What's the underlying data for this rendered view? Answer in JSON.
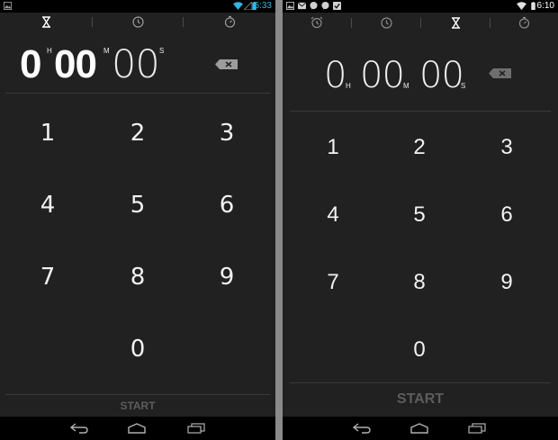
{
  "colors": {
    "background": "#212121",
    "status_bar": "#000000",
    "accent": "#33b5e5",
    "digit": "#f2f2f2",
    "start_disabled": "#5c5c5c"
  },
  "left_screen": {
    "status_bar": {
      "time": "5:33",
      "left_icons": [
        "photo-icon"
      ],
      "right_icons": [
        "wifi-icon",
        "signal-icon",
        "battery-icon"
      ]
    },
    "tabs": [
      {
        "icon": "hourglass-icon",
        "selected": true
      },
      {
        "icon": "clock-icon",
        "selected": false
      },
      {
        "icon": "stopwatch-icon",
        "selected": false
      }
    ],
    "timer": {
      "hours": "0",
      "hours_unit": "H",
      "minutes": "00",
      "minutes_unit": "M",
      "seconds": "00",
      "seconds_unit": "S"
    },
    "keypad": [
      "1",
      "2",
      "3",
      "4",
      "5",
      "6",
      "7",
      "8",
      "9",
      "0"
    ],
    "start_label": "START"
  },
  "right_screen": {
    "status_bar": {
      "time": "6:10",
      "left_icons": [
        "photo-icon",
        "email-icon",
        "chat-icon",
        "chat-icon",
        "check-icon"
      ],
      "right_icons": [
        "wifi-icon",
        "battery-icon"
      ]
    },
    "tabs": [
      {
        "icon": "alarm-icon",
        "selected": false
      },
      {
        "icon": "clock-icon",
        "selected": false
      },
      {
        "icon": "hourglass-icon",
        "selected": true
      },
      {
        "icon": "stopwatch-icon",
        "selected": false
      }
    ],
    "timer": {
      "hours": "0",
      "hours_unit": "H",
      "minutes": "00",
      "minutes_unit": "M",
      "seconds": "00",
      "seconds_unit": "S"
    },
    "keypad": [
      "1",
      "2",
      "3",
      "4",
      "5",
      "6",
      "7",
      "8",
      "9",
      "0"
    ],
    "start_label": "START"
  }
}
